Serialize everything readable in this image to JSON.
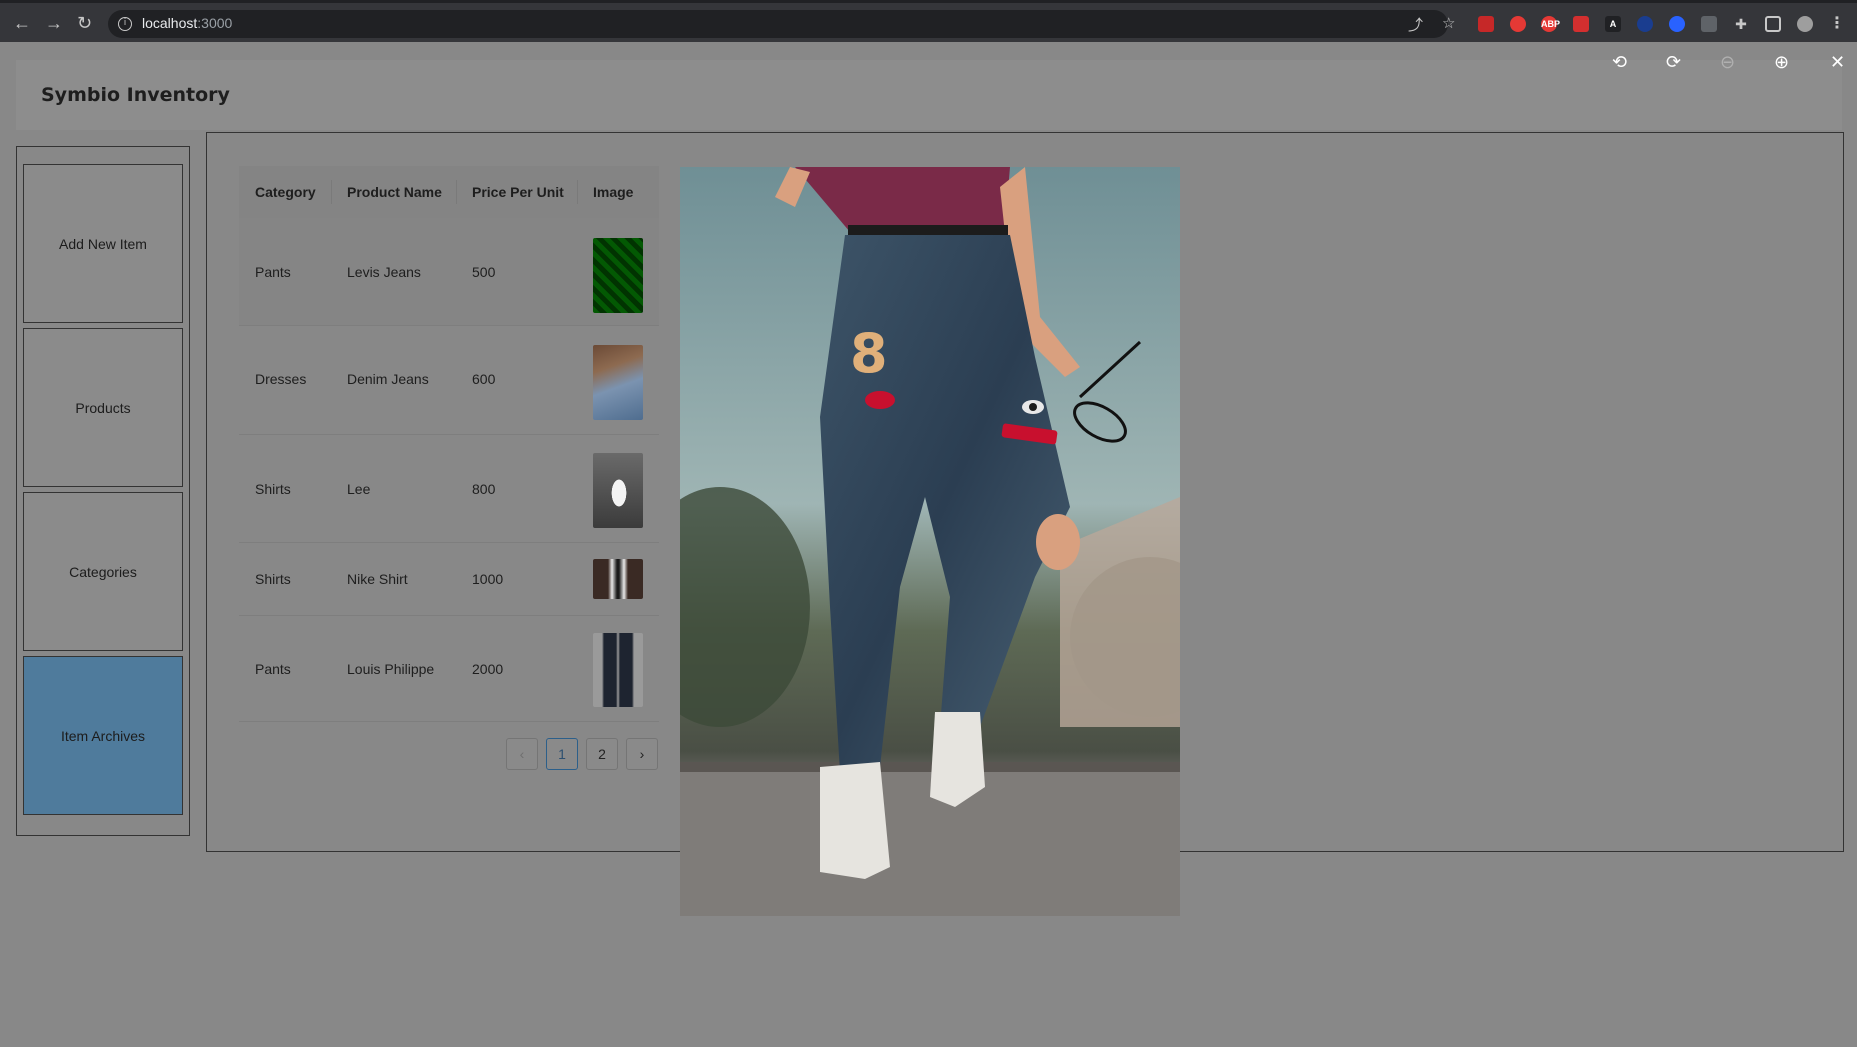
{
  "browser": {
    "url_host": "localhost",
    "url_port": ":3000"
  },
  "app": {
    "title": "Symbio Inventory"
  },
  "sidebar": {
    "items": [
      {
        "label": "Add New Item"
      },
      {
        "label": "Products"
      },
      {
        "label": "Categories"
      },
      {
        "label": "Item Archives",
        "active": true
      }
    ]
  },
  "table": {
    "columns": [
      "Category",
      "Product Name",
      "Price Per Unit",
      "Image"
    ],
    "rows": [
      {
        "category": "Pants",
        "product_name": "Levis Jeans",
        "price": "500"
      },
      {
        "category": "Dresses",
        "product_name": "Denim Jeans",
        "price": "600"
      },
      {
        "category": "Shirts",
        "product_name": "Lee",
        "price": "800"
      },
      {
        "category": "Shirts",
        "product_name": "Nike Shirt",
        "price": "1000"
      },
      {
        "category": "Pants",
        "product_name": "Louis Philippe",
        "price": "2000"
      }
    ]
  },
  "pagination": {
    "prev": "‹",
    "pages": [
      "1",
      "2"
    ],
    "current": "1",
    "next": "›"
  },
  "lightbox": {
    "tools": [
      "rotate-left-icon",
      "rotate-right-icon",
      "zoom-out-icon",
      "zoom-in-icon",
      "close-icon"
    ]
  }
}
